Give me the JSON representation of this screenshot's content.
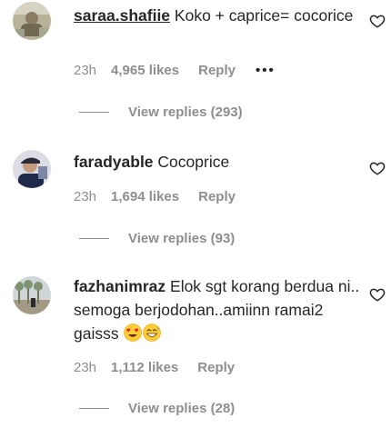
{
  "comments": [
    {
      "username": "saraa.shafiie",
      "text": "Koko + caprice= cocorice",
      "time": "23h",
      "likes": "4,965 likes",
      "reply_label": "Reply",
      "more_label": "•••",
      "view_replies": "View replies (293)"
    },
    {
      "username": "faradyable",
      "text": "Cocoprice",
      "time": "23h",
      "likes": "1,694 likes",
      "reply_label": "Reply",
      "view_replies": "View replies (93)"
    },
    {
      "username": "fazhanimraz",
      "text": "Elok sgt korang berdua ni.. semoga berjodohan..amiinn ramai2 gaisss",
      "emojis": [
        "heart-eyes-emoji",
        "grinning-sweat-emoji"
      ],
      "time": "23h",
      "likes": "1,112 likes",
      "reply_label": "Reply",
      "view_replies": "View replies (28)"
    }
  ],
  "colors": {
    "text": "#262626",
    "secondary": "#8e8e8e",
    "background": "#ffffff"
  }
}
